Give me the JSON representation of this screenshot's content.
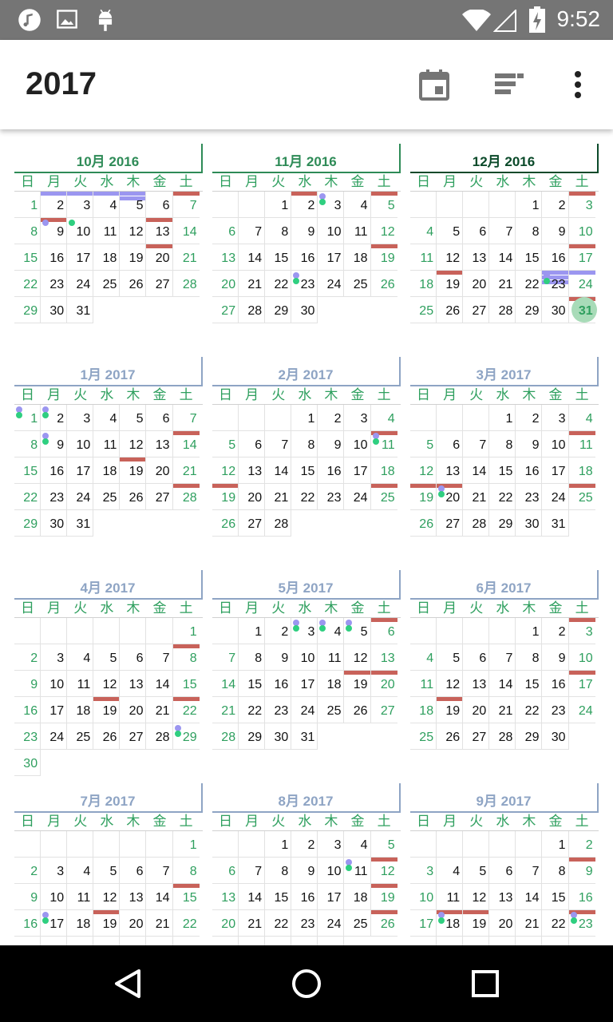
{
  "status_bar": {
    "time": "9:52",
    "left_icons": [
      "music-note-icon",
      "image-icon",
      "android-debug-icon"
    ],
    "right_icons": [
      "wifi-icon",
      "signal-icon",
      "battery-charging-icon"
    ]
  },
  "app_bar": {
    "title": "2017",
    "actions": [
      "calendar-today-icon",
      "view-agenda-icon",
      "more-vert-icon"
    ]
  },
  "weekdays": [
    "日",
    "月",
    "火",
    "水",
    "木",
    "金",
    "土"
  ],
  "months": [
    {
      "label": "10月 2016",
      "start": 0,
      "days": 31,
      "style": "green",
      "red": [
        7,
        9,
        13,
        20
      ],
      "blue": [
        [
          2,
          1
        ],
        [
          3,
          1
        ],
        [
          4,
          1
        ],
        [
          5,
          2
        ]
      ],
      "green": [
        10
      ],
      "purple": [
        9
      ],
      "today": null
    },
    {
      "label": "11月 2016",
      "start": 2,
      "days": 30,
      "style": "green",
      "red": [
        2,
        5,
        19
      ],
      "blue": [],
      "green": [
        3,
        23
      ],
      "purple": [
        3,
        23
      ],
      "today": null
    },
    {
      "label": "12月 2016",
      "start": 4,
      "days": 31,
      "style": "dark",
      "red": [
        3,
        17,
        19,
        31
      ],
      "blue": [
        [
          23,
          3
        ],
        [
          24,
          1
        ]
      ],
      "green": [
        23
      ],
      "purple": [
        23
      ],
      "today": 31
    },
    {
      "label": "1月 2017",
      "start": 0,
      "days": 31,
      "style": "blue",
      "red": [
        14,
        19,
        28
      ],
      "blue": [],
      "green": [
        1,
        2,
        9
      ],
      "purple": [
        1,
        2,
        9
      ],
      "today": null
    },
    {
      "label": "2月 2017",
      "start": 3,
      "days": 28,
      "style": "blue",
      "red": [
        11,
        19,
        25
      ],
      "blue": [],
      "green": [
        11
      ],
      "purple": [
        11
      ],
      "today": null
    },
    {
      "label": "3月 2017",
      "start": 3,
      "days": 31,
      "style": "blue",
      "red": [
        11,
        19,
        20,
        25
      ],
      "blue": [],
      "green": [
        20
      ],
      "purple": [
        20
      ],
      "today": null
    },
    {
      "label": "4月 2017",
      "start": 6,
      "days": 30,
      "style": "blue",
      "red": [
        8,
        19,
        22
      ],
      "blue": [],
      "green": [
        29
      ],
      "purple": [
        29
      ],
      "today": null
    },
    {
      "label": "5月 2017",
      "start": 1,
      "days": 31,
      "style": "blue",
      "red": [
        6,
        19,
        20
      ],
      "blue": [],
      "green": [
        3,
        4,
        5
      ],
      "purple": [
        3,
        4,
        5
      ],
      "today": null
    },
    {
      "label": "6月 2017",
      "start": 4,
      "days": 30,
      "style": "blue",
      "red": [
        3,
        17,
        19
      ],
      "blue": [],
      "green": [],
      "purple": [],
      "today": null
    },
    {
      "label": "7月 2017",
      "start": 6,
      "days": 31,
      "style": "blue",
      "red": [
        15,
        19
      ],
      "blue": [],
      "green": [
        17
      ],
      "purple": [
        17
      ],
      "today": null
    },
    {
      "label": "8月 2017",
      "start": 2,
      "days": 31,
      "style": "blue",
      "red": [
        12,
        19,
        26
      ],
      "blue": [],
      "green": [
        11
      ],
      "purple": [
        11
      ],
      "today": null
    },
    {
      "label": "9月 2017",
      "start": 5,
      "days": 30,
      "style": "blue",
      "red": [
        9,
        18,
        19,
        23
      ],
      "blue": [],
      "green": [
        18,
        23
      ],
      "purple": [
        18,
        23
      ],
      "today": null
    }
  ],
  "nav": {
    "icons": [
      "back-icon",
      "home-icon",
      "recents-icon"
    ]
  }
}
